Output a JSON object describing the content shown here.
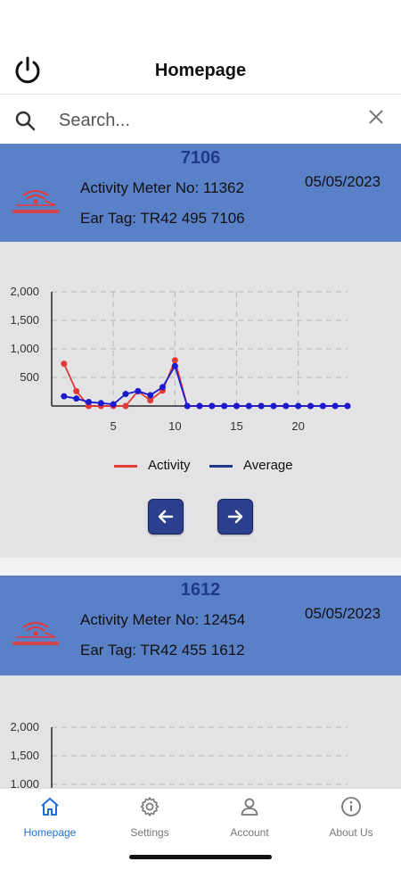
{
  "header": {
    "title": "Homepage"
  },
  "search": {
    "placeholder": "Search..."
  },
  "cards": [
    {
      "id": "7106",
      "activity_meter": "Activity Meter No: 11362",
      "ear_tag": "Ear Tag: TR42 495 7106",
      "date": "05/05/2023",
      "legend": {
        "activity": "Activity",
        "average": "Average"
      }
    },
    {
      "id": "1612",
      "activity_meter": "Activity Meter No: 12454",
      "ear_tag": "Ear Tag: TR42 455 1612",
      "date": "05/05/2023"
    }
  ],
  "chart_data": [
    {
      "type": "line",
      "x": [
        1,
        2,
        3,
        4,
        5,
        6,
        7,
        8,
        9,
        10,
        11,
        12,
        13,
        14,
        15,
        16,
        17,
        18,
        19,
        20,
        21,
        22,
        23,
        24
      ],
      "ylim": [
        0,
        2000
      ],
      "xlim": [
        0,
        24
      ],
      "yticks": [
        "500",
        "1,000",
        "1,500",
        "2,000"
      ],
      "xticks": [
        "5",
        "10",
        "15",
        "20"
      ],
      "grid": true,
      "legend_position": "bottom",
      "series": [
        {
          "name": "Activity",
          "color": "#e53935",
          "values": [
            740,
            260,
            0,
            0,
            0,
            0,
            260,
            100,
            270,
            800,
            0,
            0,
            0,
            0,
            0,
            0,
            0,
            0,
            0,
            0,
            0,
            0,
            0,
            0
          ]
        },
        {
          "name": "Average",
          "color": "#1a1ad0",
          "values": [
            170,
            130,
            70,
            50,
            30,
            210,
            260,
            190,
            330,
            700,
            0,
            0,
            0,
            0,
            0,
            0,
            0,
            0,
            0,
            0,
            0,
            0,
            0,
            0
          ]
        }
      ]
    },
    {
      "type": "line",
      "ylim": [
        0,
        2000
      ],
      "yticks": [
        "1,000",
        "1,500",
        "2,000"
      ],
      "grid": true,
      "series": []
    }
  ],
  "bottom_nav": [
    {
      "label": "Homepage",
      "icon": "home-icon",
      "active": true
    },
    {
      "label": "Settings",
      "icon": "gear-icon",
      "active": false
    },
    {
      "label": "Account",
      "icon": "user-icon",
      "active": false
    },
    {
      "label": "About Us",
      "icon": "info-icon",
      "active": false
    }
  ],
  "colors": {
    "accent": "#1f6fd8",
    "card_header": "#5a80c8",
    "nav_button": "#2c3f8f"
  }
}
